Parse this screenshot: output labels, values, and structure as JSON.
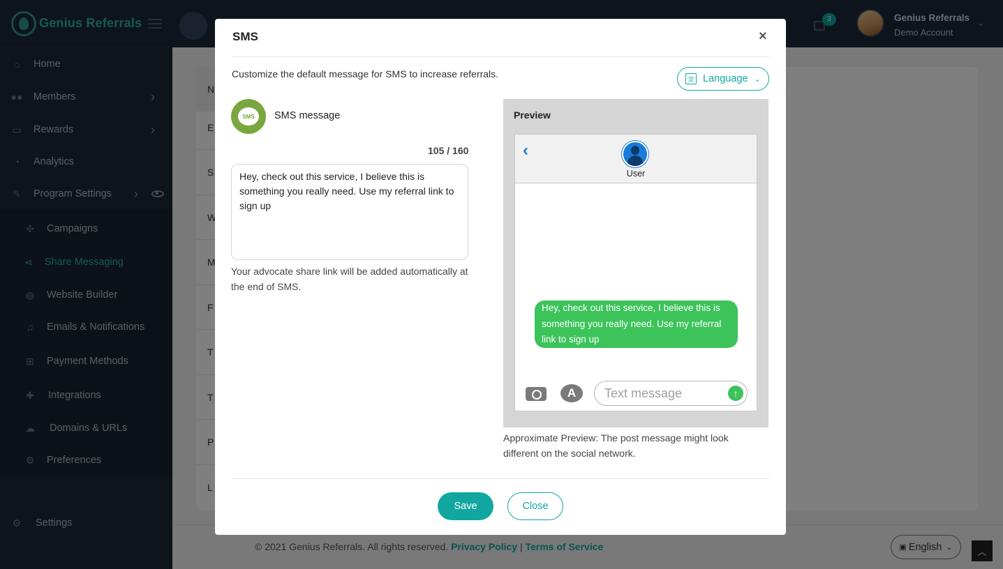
{
  "app": {
    "brand": "Genius Referrals",
    "user_name": "Genius Referrals",
    "user_account": "Demo Account",
    "cart_count": "3"
  },
  "sidebar": {
    "items": [
      {
        "label": "Home",
        "icon": "home-icon"
      },
      {
        "label": "Members",
        "icon": "users-icon"
      },
      {
        "label": "Rewards",
        "icon": "rewards-icon"
      },
      {
        "label": "Analytics",
        "icon": "dashboard-icon"
      },
      {
        "label": "Program Settings",
        "icon": "edit-icon"
      },
      {
        "label": "Campaigns",
        "icon": "campaign-icon"
      },
      {
        "label": "Share Messaging",
        "icon": "share-icon",
        "active": true
      },
      {
        "label": "Website Builder",
        "icon": "globe-icon"
      },
      {
        "label": "Emails & Notifications",
        "icon": "bell-icon"
      },
      {
        "label": "Payment Methods",
        "icon": "sitemap-icon"
      },
      {
        "label": "Integrations",
        "icon": "puzzle-icon"
      },
      {
        "label": "Domains & URLs",
        "icon": "cloud-icon"
      },
      {
        "label": "Preferences",
        "icon": "gear-icon"
      },
      {
        "label": "Settings",
        "icon": "cogs-icon"
      }
    ]
  },
  "background": {
    "row_letters": [
      "N",
      "E",
      "S",
      "W",
      "M",
      "F",
      "T",
      "T",
      "P",
      "L"
    ]
  },
  "footer": {
    "copyright": "© 2021 Genius Referrals. All rights reserved.",
    "privacy": "Privacy Policy",
    "separator": "|",
    "terms": "Terms of Service",
    "language": "English"
  },
  "modal": {
    "title": "SMS",
    "close_glyph": "×",
    "intro": "Customize the default message for SMS to increase referrals.",
    "language_button": "Language",
    "sms_badge": "SMS",
    "sms_label": "SMS message",
    "counter": "105 / 160",
    "message": "Hey, check out this service, I believe this is something you really need. Use my referral link to sign up",
    "helper": "Your advocate share link will be added automatically at the end of SMS.",
    "preview_title": "Preview",
    "preview_user": "User",
    "preview_input_placeholder": "Text message",
    "approx_note": "Approximate Preview: The post message might look different on the social network.",
    "save_label": "Save",
    "close_label": "Close"
  },
  "colors": {
    "accent": "#11a7a0",
    "sidebar_bg": "#1c2836",
    "sms_green": "#3cc35a",
    "ios_blue": "#1a7bd8"
  }
}
